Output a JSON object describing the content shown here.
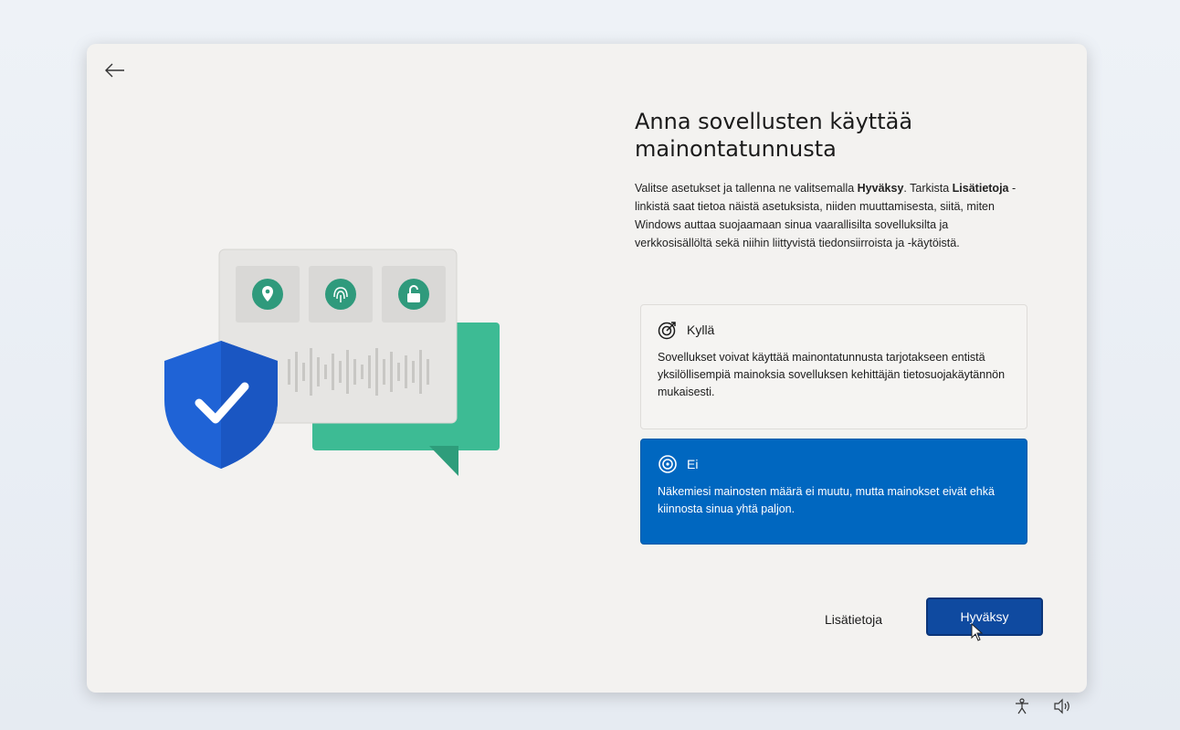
{
  "header": {
    "title": "Anna sovellusten käyttää mainontatunnusta",
    "description": {
      "part1": "Valitse asetukset ja tallenna ne valitsemalla ",
      "bold1": "Hyväksy",
      "part2": ". Tarkista ",
      "bold2": "Lisätietoja",
      "part3": " -linkistä saat tietoa näistä asetuksista, niiden muuttamisesta, siitä, miten Windows auttaa suojaamaan sinua vaarallisilta sovelluksilta ja verkkosisällöltä sekä niihin liittyvistä tiedonsiirroista ja -käytöistä."
    }
  },
  "options": [
    {
      "label": "Kyllä",
      "text": "Sovellukset voivat käyttää mainontatunnusta tarjotakseen entistä yksilöllisempiä mainoksia sovelluksen kehittäjän tietosuojakäytännön mukaisesti.",
      "selected": false
    },
    {
      "label": "Ei",
      "text": "Näkemiesi mainosten määrä ei muutu, mutta mainokset eivät ehkä kiinnosta sinua yhtä paljon.",
      "selected": true
    }
  ],
  "footer": {
    "learn_more": "Lisätietoja",
    "accept": "Hyväksy"
  },
  "icons": {
    "back": "arrow-left-icon",
    "yes": "target-arrow-icon",
    "no": "target-icon",
    "accessibility": "accessibility-icon",
    "volume": "volume-icon"
  },
  "colors": {
    "accent": "#0067c0",
    "button": "#0f4aa0",
    "shield": "#1f63d6",
    "teal": "#3dbb94"
  }
}
